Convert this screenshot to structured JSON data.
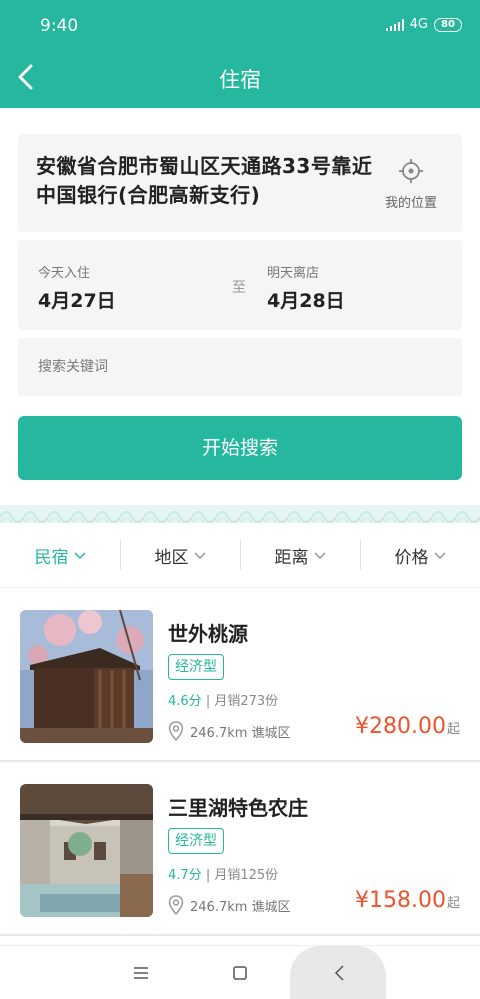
{
  "status_bar": {
    "time": "9:40",
    "network": "4G",
    "battery": "80"
  },
  "header": {
    "title": "住宿"
  },
  "search": {
    "location": "安徽省合肥市蜀山区天通路33号靠近中国银行(合肥高新支行)",
    "my_location_label": "我的位置",
    "checkin_label": "今天入住",
    "checkin_date": "4月27日",
    "separator": "至",
    "checkout_label": "明天离店",
    "checkout_date": "4月28日",
    "keyword_placeholder": "搜索关键词",
    "button_label": "开始搜索"
  },
  "filters": [
    {
      "label": "民宿",
      "active": true
    },
    {
      "label": "地区",
      "active": false
    },
    {
      "label": "距离",
      "active": false
    },
    {
      "label": "价格",
      "active": false
    }
  ],
  "hotels": [
    {
      "name": "世外桃源",
      "tag": "经济型",
      "score": "4.6分",
      "sales": " | 月销273份",
      "distance": "246.7km 谯城区",
      "price": "¥280.00",
      "price_suffix": "起"
    },
    {
      "name": "三里湖特色农庄",
      "tag": "经济型",
      "score": "4.7分",
      "sales": " | 月销125份",
      "distance": "246.7km 谯城区",
      "price": "¥158.00",
      "price_suffix": "起"
    }
  ],
  "icons": {
    "back": "back-arrow-icon",
    "locate": "crosshair-icon",
    "filter_arrow": "chevron-down-icon",
    "distance": "map-pin-icon",
    "nav_menu": "menu-icon",
    "nav_home": "square-icon",
    "nav_back": "chevron-left-icon"
  },
  "colors": {
    "brand": "#25b89f",
    "price": "#f0522b"
  }
}
